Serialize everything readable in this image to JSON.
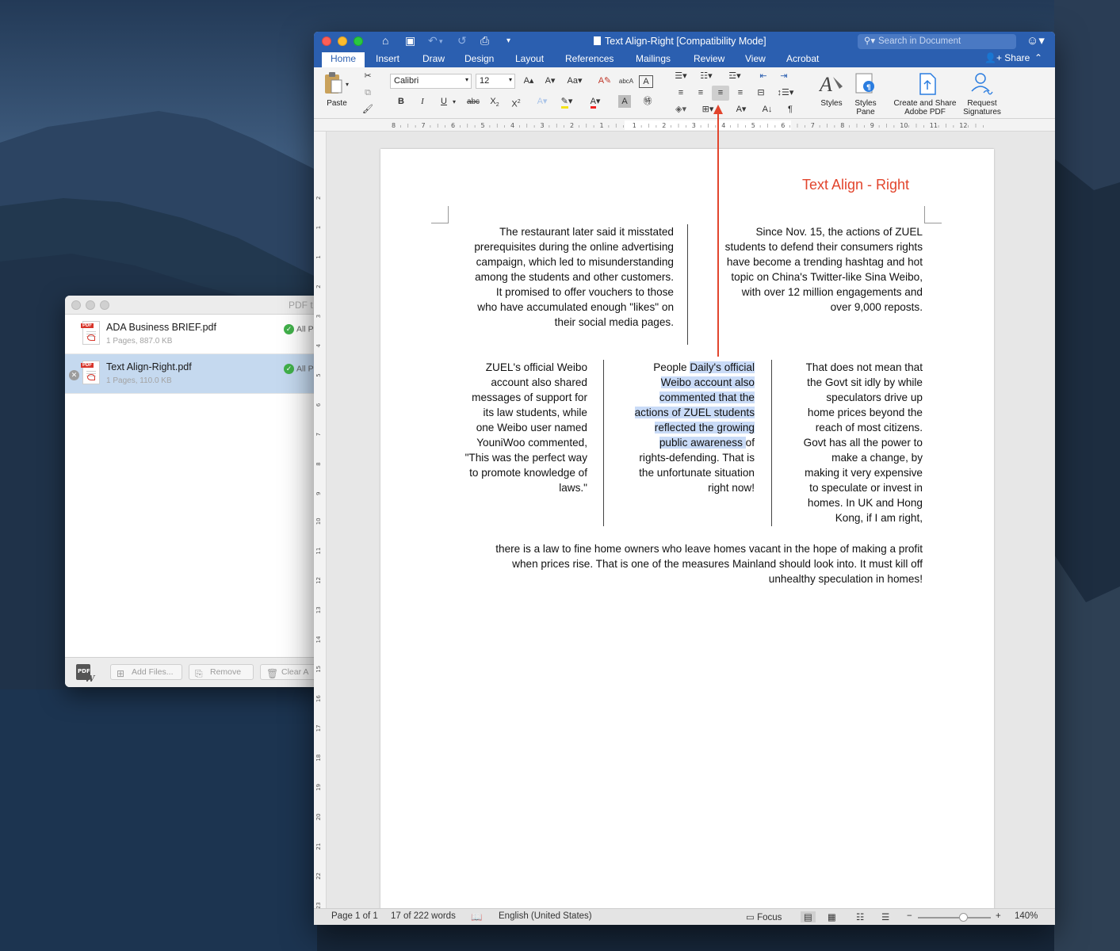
{
  "pdf_window": {
    "title": "PDF t",
    "files": [
      {
        "name": "ADA Business BRIEF.pdf",
        "meta": "1 Pages, 887.0 KB",
        "status": "All P"
      },
      {
        "name": "Text Align-Right.pdf",
        "meta": "1 Pages, 110.0 KB",
        "status": "All P"
      }
    ],
    "buttons": {
      "add": "Add Files...",
      "remove": "Remove",
      "clear": "Clear A"
    },
    "logo_text": "PDF"
  },
  "word": {
    "doc_title": "Text Align-Right [Compatibility Mode]",
    "search_placeholder": "Search in Document",
    "tabs": [
      "Home",
      "Insert",
      "Draw",
      "Design",
      "Layout",
      "References",
      "Mailings",
      "Review",
      "View",
      "Acrobat"
    ],
    "share_label": "Share",
    "ribbon": {
      "paste": "Paste",
      "font_name": "Calibri",
      "font_size": "12",
      "bold": "B",
      "italic": "I",
      "underline": "U",
      "strike": "abc",
      "subscript": "X",
      "superscript": "X",
      "styles": "Styles",
      "styles_pane_1": "Styles",
      "styles_pane_2": "Pane",
      "create_share_1": "Create and Share",
      "create_share_2": "Adobe PDF",
      "request_1": "Request",
      "request_2": "Signatures"
    },
    "ruler_h": [
      "8",
      "7",
      "6",
      "5",
      "4",
      "3",
      "2",
      "1",
      "1",
      "2",
      "3",
      "4",
      "5",
      "6",
      "7",
      "8",
      "9",
      "10",
      "11",
      "12"
    ],
    "ruler_v": [
      "2",
      "1",
      "1",
      "2",
      "3",
      "4",
      "5",
      "6",
      "7",
      "8",
      "9",
      "10",
      "11",
      "12",
      "13",
      "14",
      "15",
      "16",
      "17",
      "18",
      "19",
      "20",
      "21",
      "22",
      "23"
    ],
    "annotation": "Text Align - Right",
    "section1": {
      "col1": [
        "The restaurant later said it misstated",
        "prerequisites during the online advertising",
        "campaign, which led to misunderstanding",
        "among the students and other customers.",
        "It promised to offer vouchers to those",
        "who have accumulated enough \"likes\" on",
        "their social media pages."
      ],
      "col2": [
        "Since Nov. 15, the actions of ZUEL",
        "students to defend their consumers rights",
        "have become a trending hashtag and hot",
        "topic on China's Twitter-like Sina Weibo,",
        "with over 12 million engagements and",
        "over 9,000 reposts."
      ]
    },
    "section2": {
      "col1": [
        "ZUEL's official Weibo",
        "account also shared",
        "messages of support for",
        "its law students, while",
        "one Weibo user named",
        "YouniWoo commented,",
        "\"This was the perfect way",
        "to promote knowledge of",
        "laws.\""
      ],
      "col2_line1_a": "People ",
      "col2_line1_b": "Daily's official",
      "col2_hl": [
        "Weibo account also",
        "commented that the",
        "actions of ZUEL students",
        "reflected the growing"
      ],
      "col2_line6_a": "public awareness ",
      "col2_line6_b": "of",
      "col2_rest": [
        "rights-defending. That is",
        "the unfortunate situation",
        "right now!"
      ],
      "col3": [
        "That does not mean that",
        "the Govt sit idly by while",
        "speculators drive up",
        "home prices beyond the",
        "reach of most citizens.",
        "Govt has all the power to",
        "make a change, by",
        "making it very expensive",
        "to speculate or invest in",
        "homes. In UK and Hong",
        "Kong, if I am right,"
      ]
    },
    "section3": [
      "there is a law to fine home owners who leave homes vacant in the hope of making a profit",
      "when prices rise. That is one of the measures Mainland should look into. It must kill off",
      "unhealthy speculation in homes!"
    ],
    "status": {
      "page": "Page 1 of 1",
      "words": "17 of 222 words",
      "language": "English (United States)",
      "focus": "Focus",
      "zoom": "140%"
    }
  },
  "colors": {
    "word_blue": "#2b5fb0",
    "annotation_red": "#e2452d",
    "selection": "#c9dbf7"
  }
}
